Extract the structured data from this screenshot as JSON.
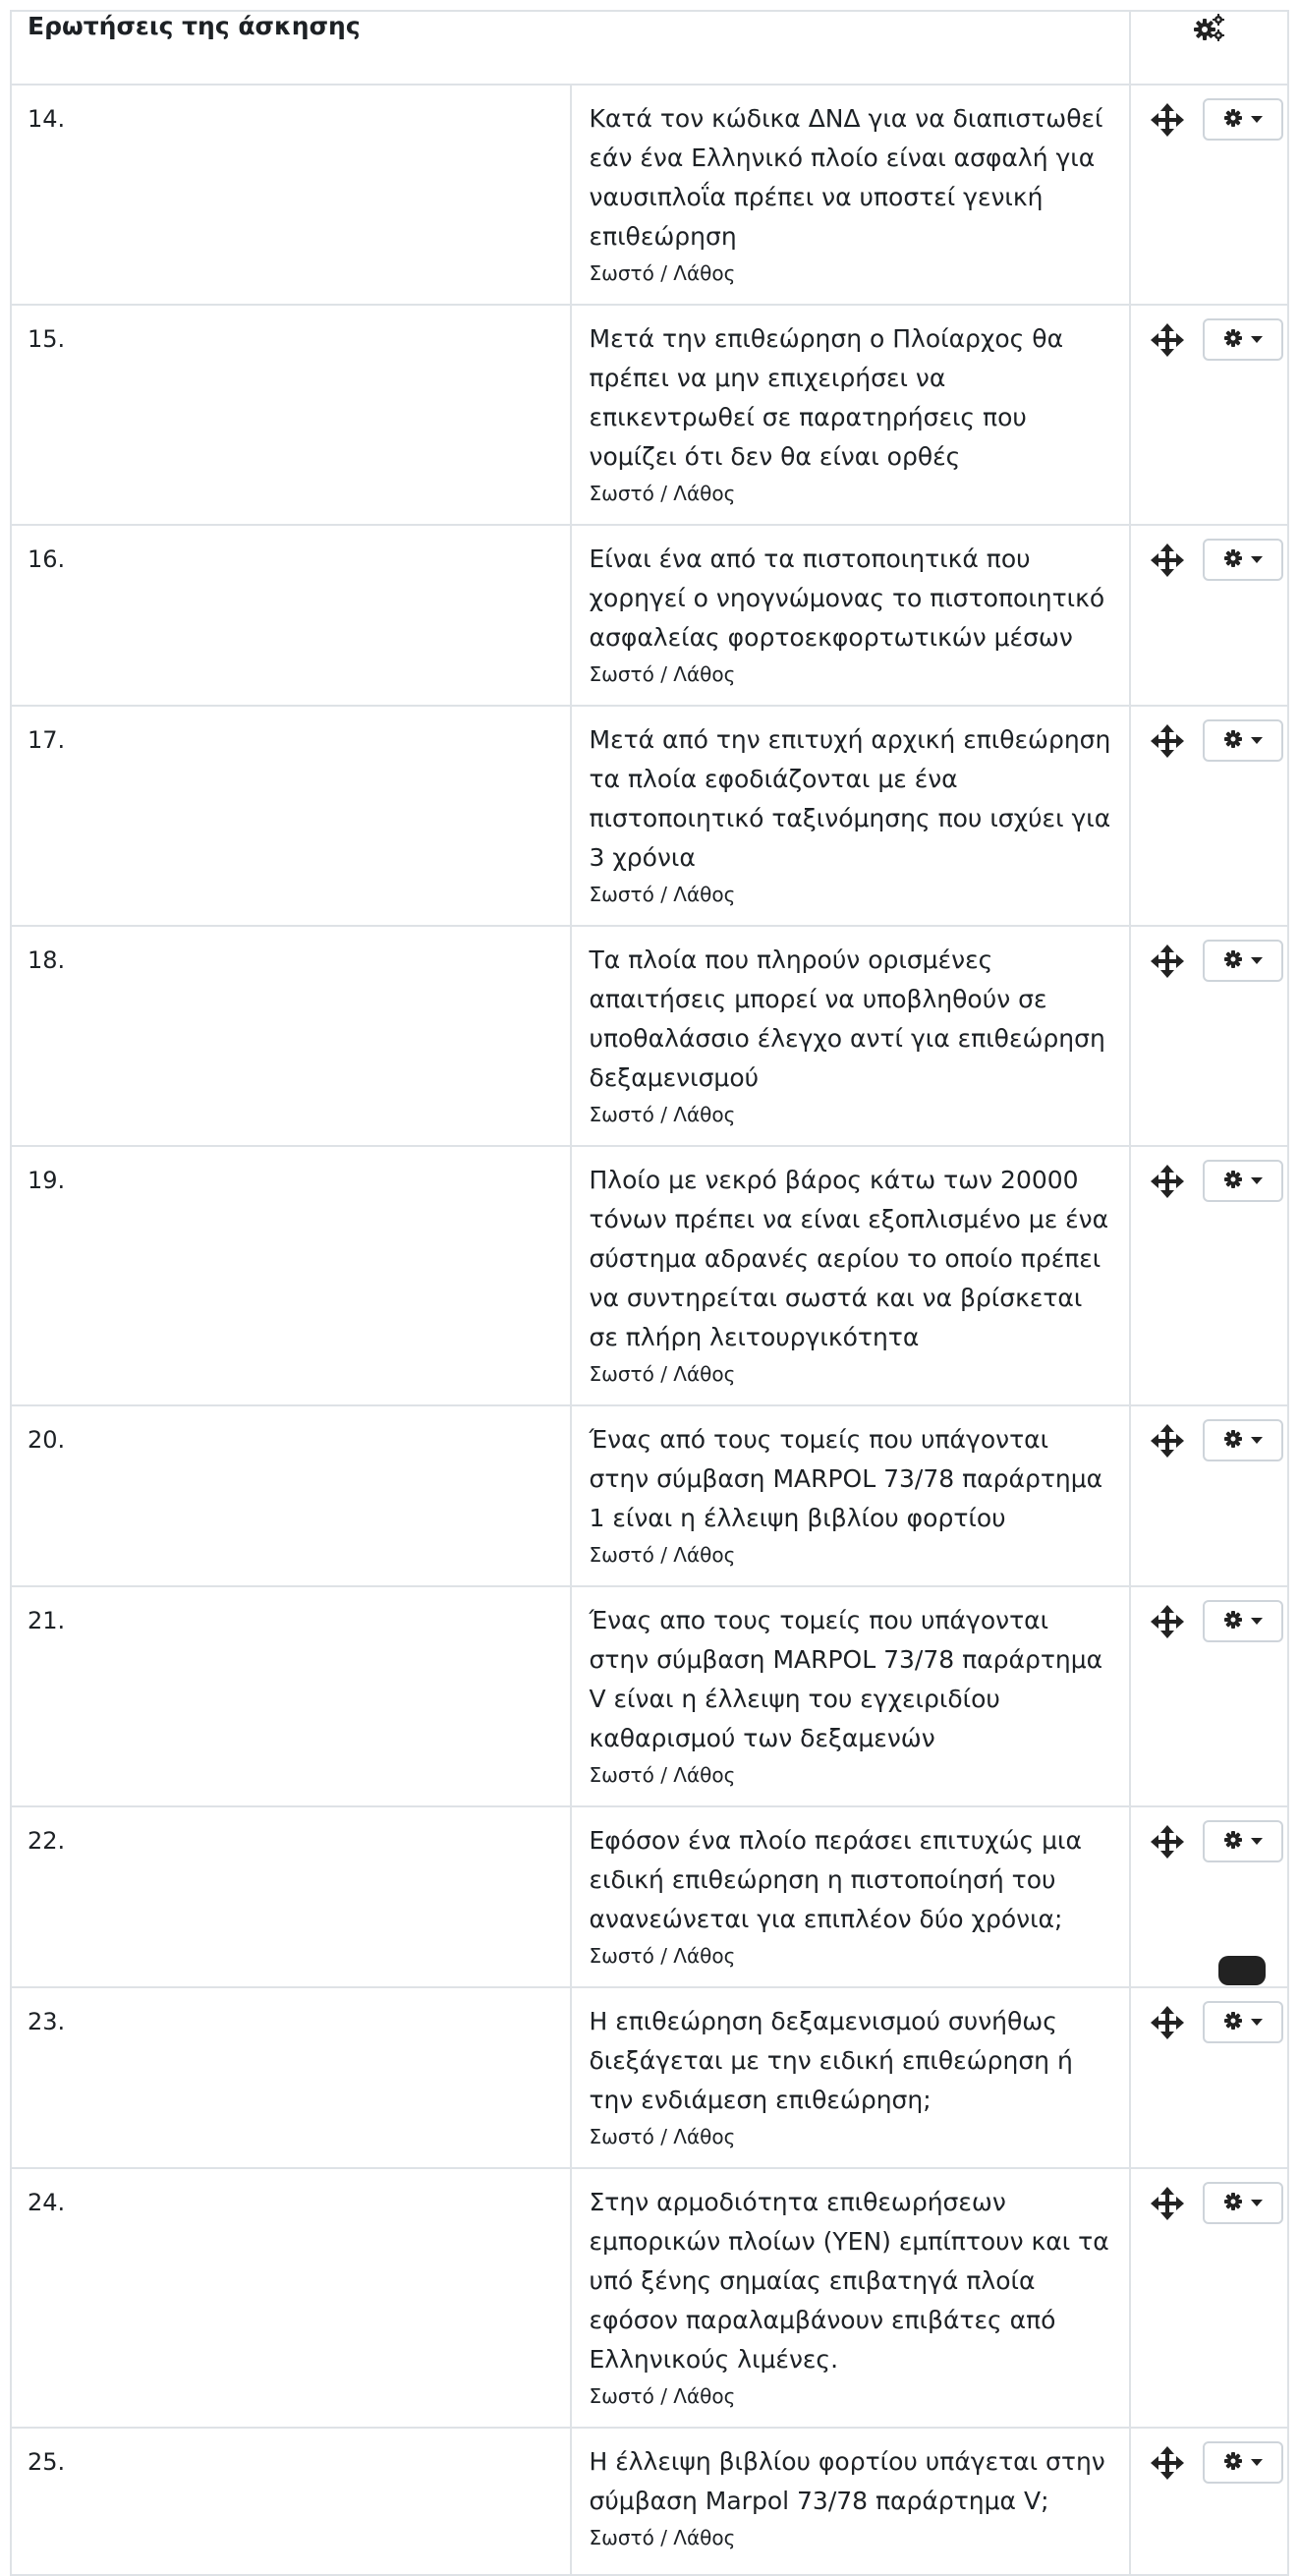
{
  "header": {
    "title": "Ερωτήσεις της άσκησης",
    "settings_icon": "gears-icon"
  },
  "questions": [
    {
      "number": "14.",
      "text": "Κατά τον κώδικα ΔΝΔ για να διαπιστωθεί εάν ένα Ελληνικό πλοίο είναι ασφαλή για ναυσιπλοΐα πρέπει να υποστεί γενική επιθεώρηση",
      "type": "Σωστό / Λάθος"
    },
    {
      "number": "15.",
      "text": "Μετά την επιθεώρηση ο Πλοίαρχος θα πρέπει να μην επιχειρήσει να επικεντρωθεί σε παρατηρήσεις που νομίζει ότι δεν θα είναι ορθές",
      "type": "Σωστό / Λάθος"
    },
    {
      "number": "16.",
      "text": "Είναι ένα από τα πιστοποιητικά που χορηγεί ο νηογνώμονας το πιστοποιητικό ασφαλείας φορτοεκφορτωτικών μέσων",
      "type": "Σωστό / Λάθος"
    },
    {
      "number": "17.",
      "text": "Μετά από την επιτυχή αρχική επιθεώρηση τα πλοία εφοδιάζονται με ένα πιστοποιητικό ταξινόμησης που ισχύει για 3 χρόνια",
      "type": "Σωστό / Λάθος"
    },
    {
      "number": "18.",
      "text": "Τα πλοία που πληρούν ορισμένες απαιτήσεις μπορεί να υποβληθούν σε υποθαλάσσιο έλεγχο αντί για επιθεώρηση δεξαμενισμού",
      "type": "Σωστό / Λάθος"
    },
    {
      "number": "19.",
      "text": "Πλοίο με νεκρό βάρος κάτω των 20000 τόνων πρέπει να είναι εξοπλισμένο με ένα σύστημα αδρανές αερίου το οποίο πρέπει να συντηρείται σωστά και να βρίσκεται σε πλήρη λειτουργικότητα",
      "type": "Σωστό / Λάθος"
    },
    {
      "number": "20.",
      "text": "Ένας από τους τομείς που υπάγονται στην σύμβαση MARPOL 73/78 παράρτημα 1 είναι η έλλειψη βιβλίου φορτίου",
      "type": "Σωστό / Λάθος"
    },
    {
      "number": "21.",
      "text": "Ένας απο τους τομείς που υπάγονται στην σύμβαση MARPOL 73/78 παράρτημα V είναι η έλλειψη του εγχειριδίου καθαρισμού των δεξαμενών",
      "type": "Σωστό / Λάθος"
    },
    {
      "number": "22.",
      "text": "Εφόσον ένα πλοίο περάσει επιτυχώς μια ειδική επιθεώρηση η πιστοποίησή του ανανεώνεται για επιπλέον δύο χρόνια;",
      "type": "Σωστό / Λάθος"
    },
    {
      "number": "23.",
      "text": "Η επιθεώρηση δεξαμενισμού συνήθως διεξάγεται με την ειδική επιθεώρηση ή την ενδιάμεση επιθεώρηση;",
      "type": "Σωστό / Λάθος"
    },
    {
      "number": "24.",
      "text": "Στην αρμοδιότητα επιθεωρήσεων εμπορικών πλοίων (ΥΕΝ) εμπίπτουν και τα υπό ξένης σημαίας επιβατηγά πλοία εφόσον παραλαμβάνουν επιβάτες από Ελληνικούς λιμένες.",
      "type": "Σωστό / Λάθος"
    },
    {
      "number": "25.",
      "text": "Η έλλειψη βιβλίου φορτίου υπάγεται στην σύμβαση Marpol 73/78 παράρτημα V;",
      "type": "Σωστό / Λάθος"
    }
  ],
  "row_icons": {
    "move": "move-arrows-icon",
    "actions": "gear-icon",
    "caret": "caret-down-icon"
  }
}
